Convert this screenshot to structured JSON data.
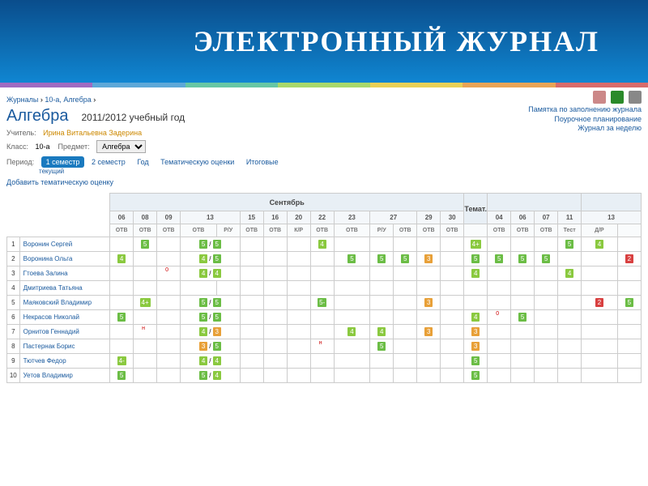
{
  "header": {
    "title": "ЭЛЕКТРОННЫЙ ЖУРНАЛ"
  },
  "breadcrumb": [
    "Журналы",
    "10-а, Алгебра"
  ],
  "subject": "Алгебра",
  "year": "2011/2012 учебный год",
  "teacher_label": "Учитель:",
  "teacher_name": "Ирина Витальевна Задерина",
  "class_label": "Класс:",
  "class_value": "10-а",
  "subj_label": "Предмет:",
  "subj_select": "Алгебра",
  "period_label": "Период:",
  "period_tabs": [
    "1 семестр",
    "2 семестр",
    "Год",
    "Тематическую оценки",
    "Итоговые"
  ],
  "period_sub": "текущий",
  "add_thematic": "Добавить тематическую оценку",
  "right_links": [
    "Памятка по заполнению журнала",
    "Поурочное планирование",
    "Журнал за неделю"
  ],
  "month": "Сентябрь",
  "days": [
    "06",
    "08",
    "09",
    "13",
    "15",
    "16",
    "20",
    "22",
    "23",
    "27",
    "29",
    "30"
  ],
  "types": [
    "ОТВ",
    "ОТВ",
    "ОТВ",
    "ОТВ",
    "Р/У",
    "ОТВ",
    "ОТВ",
    "К/Р",
    "ОТВ",
    "ОТВ",
    "Р/У",
    "ОТВ",
    "ОТВ",
    "ОТВ"
  ],
  "extra_cols": {
    "themat": "Темат.",
    "days2": [
      "04",
      "06",
      "07",
      "11",
      "13"
    ],
    "types2": [
      "ОТВ",
      "ОТВ",
      "ОТВ",
      "Тест",
      "Д/Р"
    ]
  },
  "students": [
    {
      "n": "1",
      "name": "Воронин Сергей"
    },
    {
      "n": "2",
      "name": "Воронина Ольга"
    },
    {
      "n": "3",
      "name": "Гтоева Залина"
    },
    {
      "n": "4",
      "name": "Дмитриева Татьяна"
    },
    {
      "n": "5",
      "name": "Маяковский Владимир"
    },
    {
      "n": "6",
      "name": "Некрасов Николай"
    },
    {
      "n": "7",
      "name": "Орнитов Геннадий"
    },
    {
      "n": "8",
      "name": "Пастернак Борис"
    },
    {
      "n": "9",
      "name": "Тютчев Федор"
    },
    {
      "n": "10",
      "name": "Уетов Владимир"
    }
  ],
  "grades": {
    "1": {
      "1": "5",
      "3": "5",
      "4": "5",
      "8": "4",
      "14": "4+",
      "18": "5",
      "19": "4"
    },
    "2": {
      "0": "4",
      "3": "4",
      "4": "5",
      "9": "5",
      "10": "5",
      "11": "5",
      "12": "3",
      "14": "5",
      "15": "5",
      "16": "5",
      "17": "5",
      "20": "2"
    },
    "3": {
      "2": "0",
      "3": "4",
      "4": "4",
      "14": "4",
      "18": "4"
    },
    "4": {},
    "5": {
      "1": "4+",
      "3": "5",
      "4": "5",
      "8": "5-",
      "12": "3",
      "19": "2",
      "20": "5"
    },
    "6": {
      "0": "5",
      "3": "5",
      "4": "5",
      "14": "4",
      "15": "0",
      "16": "5"
    },
    "7": {
      "1": "н",
      "3": "4",
      "4": "3",
      "9": "4",
      "10": "4",
      "12": "3",
      "14": "3"
    },
    "8": {
      "3": "3",
      "4": "5",
      "8": "н",
      "10": "5",
      "14": "3"
    },
    "9": {
      "0": "4-",
      "3": "4",
      "4": "4",
      "14": "5"
    },
    "10": {
      "0": "5",
      "3": "5",
      "4": "4",
      "14": "5"
    }
  },
  "chart_data": null
}
